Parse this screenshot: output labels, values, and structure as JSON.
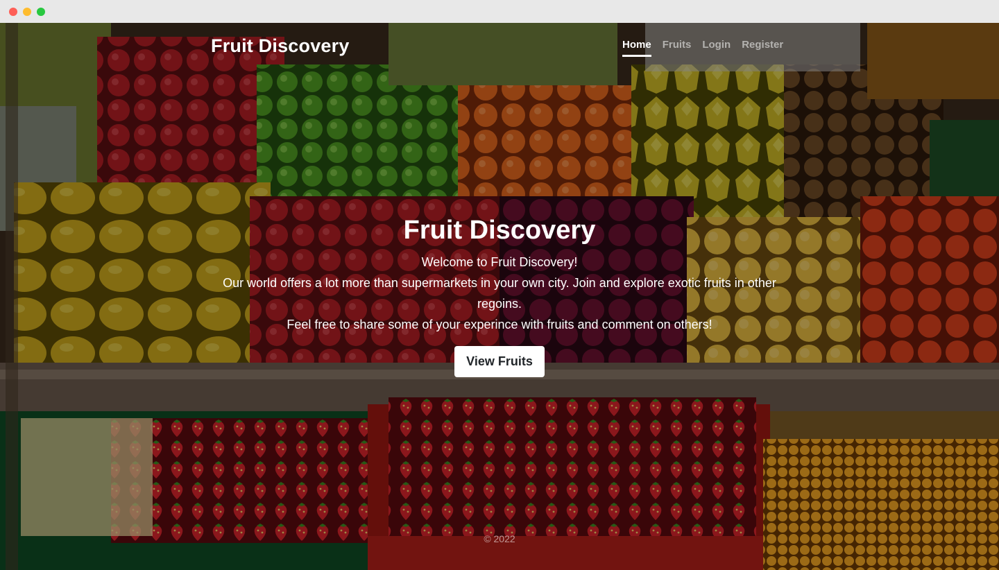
{
  "brand": {
    "name": "Fruit Discovery"
  },
  "nav": {
    "items": [
      {
        "label": "Home",
        "active": true
      },
      {
        "label": "Fruits",
        "active": false
      },
      {
        "label": "Login",
        "active": false
      },
      {
        "label": "Register",
        "active": false
      }
    ]
  },
  "hero": {
    "title": "Fruit Discovery",
    "lead1": "Welcome to Fruit Discovery!",
    "lead2": "Our world offers a lot more than supermarkets in your own city. Join and explore exotic fruits in other regoins.",
    "lead3": "Feel free to share some of your experince with fruits and comment on others!",
    "button_label": "View Fruits"
  },
  "footer": {
    "text": "© 2022"
  },
  "colors": {
    "overlay": "#000000",
    "text": "#ffffff",
    "button_bg": "#ffffff",
    "button_text": "#212529"
  }
}
